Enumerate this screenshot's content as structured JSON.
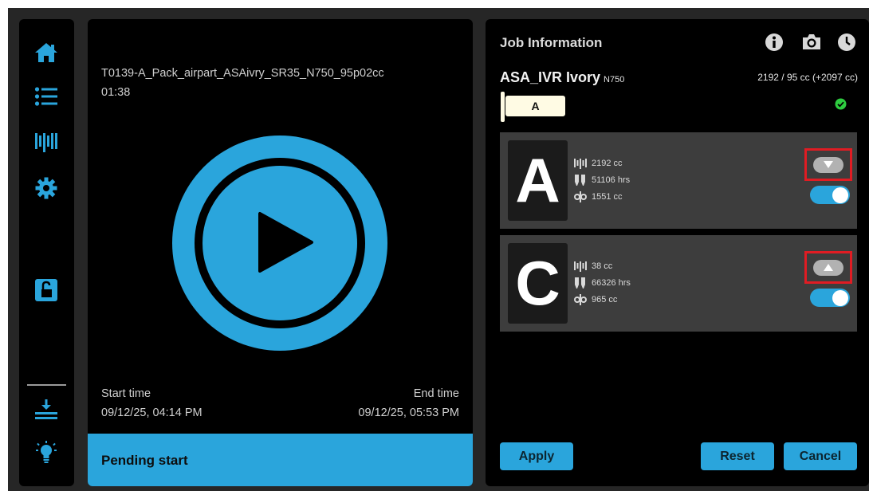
{
  "sidebar": {
    "items": [
      {
        "icon": "home-icon"
      },
      {
        "icon": "list-icon"
      },
      {
        "icon": "material-icon"
      },
      {
        "icon": "gear-icon"
      },
      {
        "icon": "unlock-icon"
      },
      {
        "icon": "download-tray-icon"
      },
      {
        "icon": "lightbulb-icon"
      }
    ]
  },
  "job": {
    "name": "T0139-A_Pack_airpart_ASAivry_SR35_N750_95p02cc",
    "duration": "01:38",
    "start_label": "Start time",
    "start_value": "09/12/25, 04:14 PM",
    "end_label": "End time",
    "end_value": "09/12/25, 05:53 PM",
    "status": "Pending start"
  },
  "panel": {
    "title": "Job Information",
    "header_icons": [
      "info-icon",
      "camera-icon",
      "clock-icon"
    ],
    "material_name": "ASA_IVR Ivory",
    "material_code": "N750",
    "material_summary": "2192 / 95 cc (+2097 cc)",
    "active_slot": "A"
  },
  "cards": [
    {
      "letter": "A",
      "material_amount": "2192 cc",
      "hours": "51106 hrs",
      "support_amount": "1551 cc",
      "chip_direction": "down",
      "toggle_on": true
    },
    {
      "letter": "C",
      "material_amount": "38 cc",
      "hours": "66326 hrs",
      "support_amount": "965 cc",
      "chip_direction": "up",
      "toggle_on": true
    }
  ],
  "actions": {
    "apply": "Apply",
    "reset": "Reset",
    "cancel": "Cancel"
  },
  "colors": {
    "accent": "#2aa5dc",
    "highlight": "#e01c23",
    "ok": "#2ecc40",
    "slot": "#fffbe4"
  }
}
